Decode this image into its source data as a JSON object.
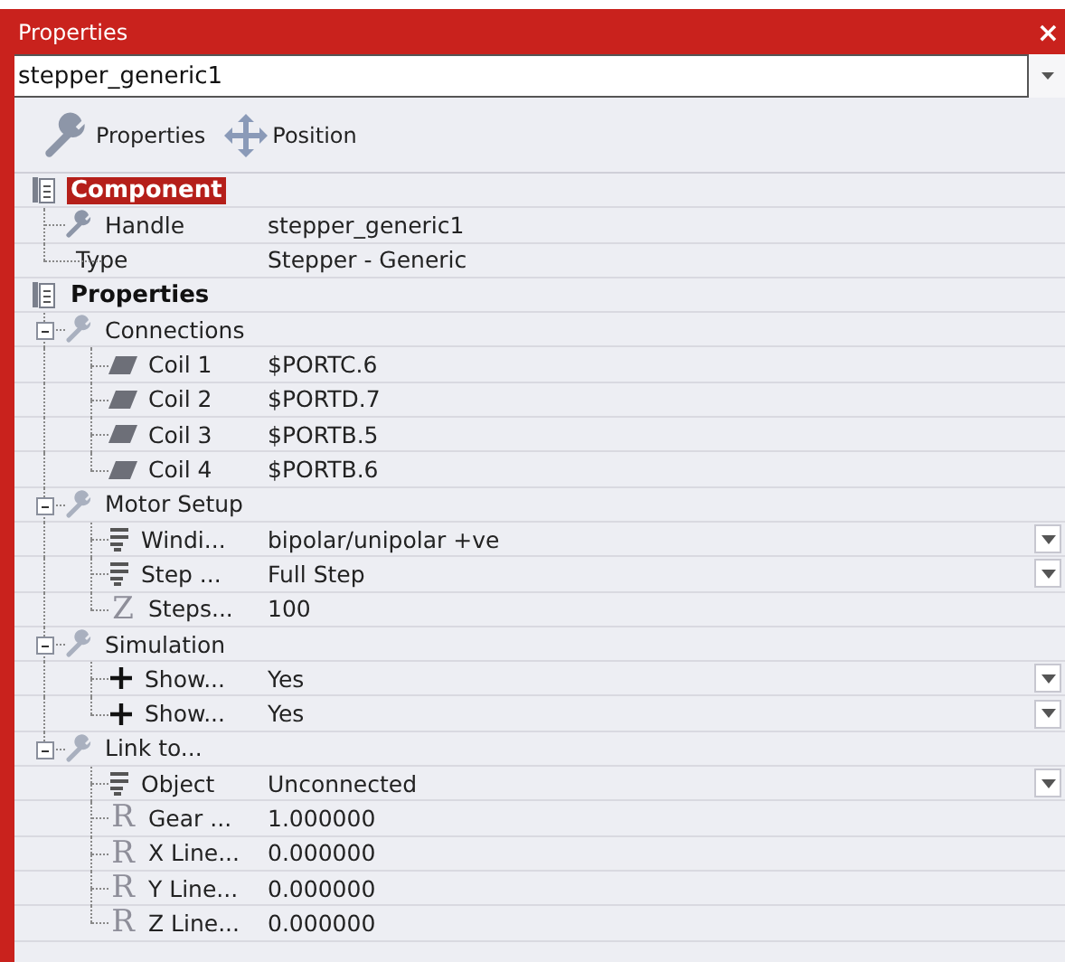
{
  "window": {
    "title": "Properties",
    "close": "×"
  },
  "selector": {
    "value": "stepper_generic1"
  },
  "toolbar": [
    {
      "label": "Properties",
      "kind": "wrench"
    },
    {
      "label": "Position",
      "kind": "move"
    }
  ],
  "sections": [
    {
      "label": "Component",
      "selected": true,
      "items": [
        {
          "name": "Handle",
          "value": "stepper_generic1",
          "kind": "wrench",
          "dropdown": false
        },
        {
          "name": "Type",
          "value": "Stepper - Generic",
          "kind": "line",
          "dropdown": false
        }
      ]
    },
    {
      "label": "Properties",
      "selected": false,
      "items": [
        {
          "name": "Connections",
          "kind": "group",
          "expanded": true,
          "children": [
            {
              "name": "Coil 1",
              "value": "$PORTC.6",
              "kind": "coil",
              "dropdown": false
            },
            {
              "name": "Coil 2",
              "value": "$PORTD.7",
              "kind": "coil",
              "dropdown": false
            },
            {
              "name": "Coil 3",
              "value": "$PORTB.5",
              "kind": "coil",
              "dropdown": false
            },
            {
              "name": "Coil 4",
              "value": "$PORTB.6",
              "kind": "coil",
              "dropdown": false
            }
          ]
        },
        {
          "name": "Motor Setup",
          "kind": "group",
          "expanded": true,
          "children": [
            {
              "name": "Windi...",
              "value": "bipolar/unipolar +ve",
              "kind": "list",
              "dropdown": true
            },
            {
              "name": "Step ...",
              "value": "Full Step",
              "kind": "list",
              "dropdown": true
            },
            {
              "name": "Steps...",
              "value": "100",
              "kind": "symbol",
              "symbol": "Z",
              "dropdown": false
            }
          ]
        },
        {
          "name": "Simulation",
          "kind": "group",
          "expanded": true,
          "children": [
            {
              "name": "Show...",
              "value": "Yes",
              "kind": "plus",
              "dropdown": true
            },
            {
              "name": "Show...",
              "value": "Yes",
              "kind": "plus",
              "dropdown": true
            }
          ]
        },
        {
          "name": "Link to...",
          "kind": "group",
          "expanded": true,
          "children": [
            {
              "name": "Object",
              "value": "Unconnected",
              "kind": "list",
              "dropdown": true
            },
            {
              "name": "Gear ...",
              "value": "1.000000",
              "kind": "symbol",
              "symbol": "R",
              "dropdown": false
            },
            {
              "name": "X Line...",
              "value": "0.000000",
              "kind": "symbol",
              "symbol": "R",
              "dropdown": false
            },
            {
              "name": "Y Line...",
              "value": "0.000000",
              "kind": "symbol",
              "symbol": "R",
              "dropdown": false
            },
            {
              "name": "Z Line...",
              "value": "0.000000",
              "kind": "symbol",
              "symbol": "R",
              "dropdown": false
            }
          ]
        }
      ]
    }
  ]
}
